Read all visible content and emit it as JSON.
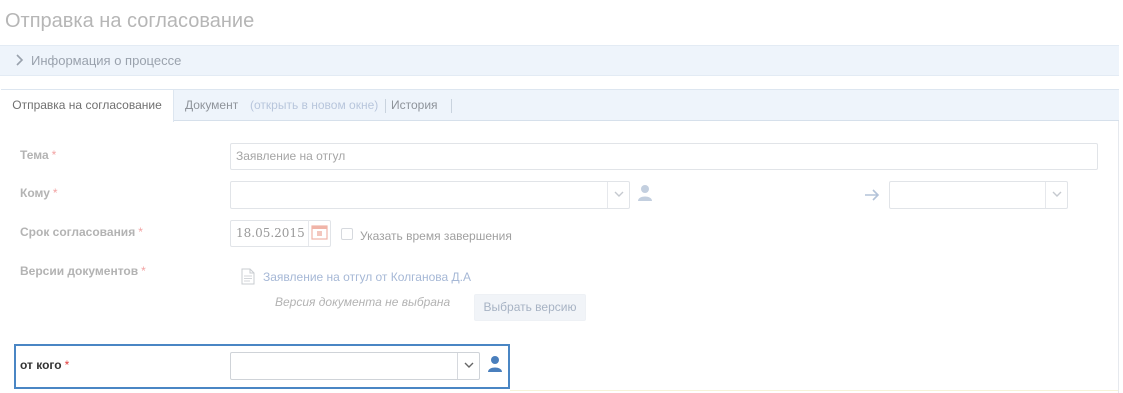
{
  "page": {
    "title": "Отправка на согласование"
  },
  "process_info": {
    "label": "Информация о процессе"
  },
  "tabs": {
    "active": "Отправка на согласование",
    "document": "Документ",
    "open_new_window": "(открыть в новом окне)",
    "history": "История"
  },
  "form": {
    "subject": {
      "label": "Тема",
      "required_mark": "*",
      "value": "Заявление на отгул"
    },
    "to": {
      "label": "Кому",
      "required_mark": "*",
      "value": "",
      "forward_value": ""
    },
    "deadline": {
      "label": "Срок согласования",
      "required_mark": "*",
      "value": "18.05.2015",
      "specify_time_label": "Указать время завершения",
      "specify_time_checked": false
    },
    "doc_versions": {
      "label": "Версии документов",
      "required_mark": "*",
      "document_link": "Заявление на отгул от Колганова Д.А",
      "note": "Версия документа не выбрана",
      "choose_button": "Выбрать версию"
    },
    "from": {
      "label": "от кого",
      "required_mark": "*",
      "value": ""
    }
  },
  "colors": {
    "highlight_border": "#4a86c4",
    "required": "#e23b3b",
    "user_icon": "#4a7fbd"
  },
  "icons": [
    "chevron-right-icon",
    "user-icon",
    "arrow-right-icon",
    "calendar-icon",
    "document-icon",
    "chevron-down-icon"
  ]
}
